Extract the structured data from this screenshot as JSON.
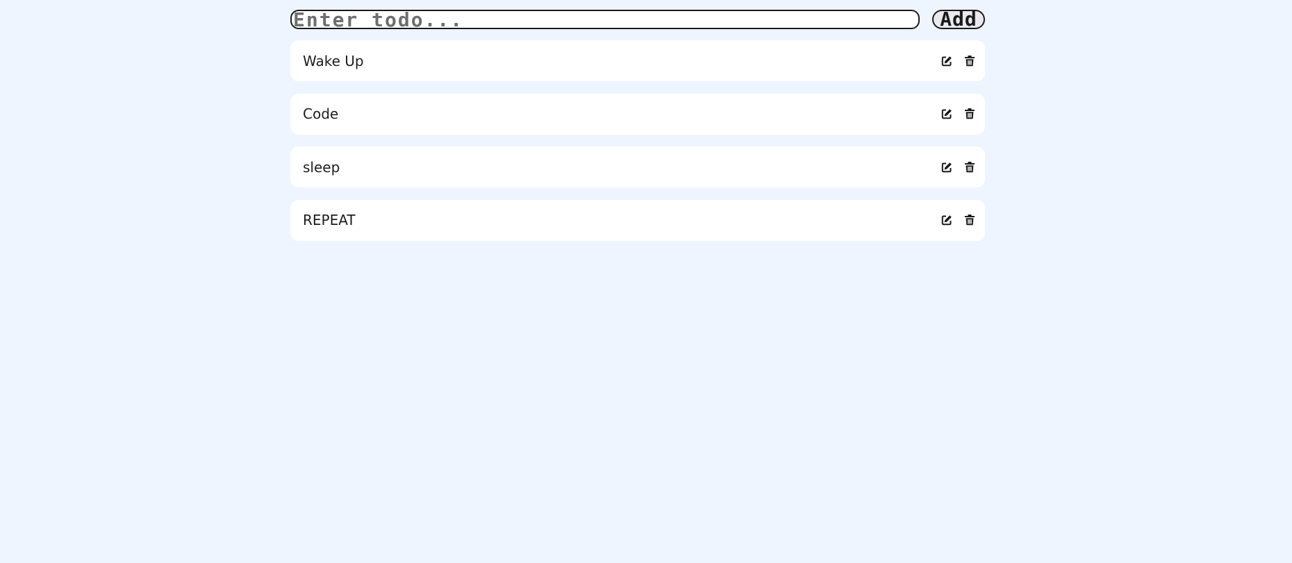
{
  "form": {
    "input_value": "",
    "input_placeholder": "Enter todo...",
    "add_label": "Add"
  },
  "todos": [
    {
      "text": "Wake Up"
    },
    {
      "text": "Code"
    },
    {
      "text": "sleep"
    },
    {
      "text": "REPEAT"
    }
  ],
  "icons": {
    "edit": "edit-icon",
    "delete": "trash-icon"
  },
  "colors": {
    "background": "#eef5ff",
    "card": "#ffffff",
    "text": "#1d1d1f",
    "icon": "#1a1a1a"
  }
}
